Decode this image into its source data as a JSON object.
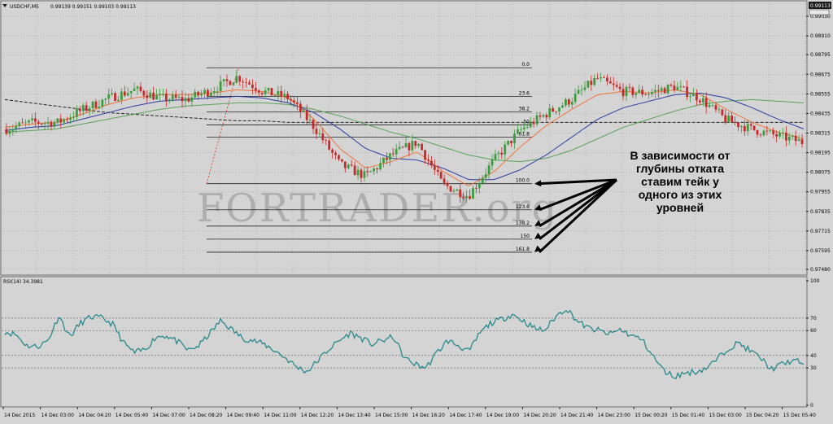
{
  "window": {
    "symbol_label": "USDCHF,M5",
    "ohlc_label": "0.99139 0.99151 0.99103 0.99113",
    "current_price_tag": "0.99113",
    "watermark": "FORTRADER.org"
  },
  "colors": {
    "background": "#d4d4d4",
    "grid": "#9a9a9a",
    "bull_candle": "#3c9b3c",
    "bear_candle": "#c82828",
    "ma_fast": "#f0743c",
    "ma_mid": "#2c3ca0",
    "ma_slow": "#5aa05a",
    "ma_long": "#222222",
    "rsi": "#2a8a8a",
    "fib": "#222222"
  },
  "annotation": {
    "lines": [
      "В зависимости от",
      "глубины отката",
      "ставим тейк у",
      "одного из этих",
      "уровней"
    ]
  },
  "chart_data": {
    "type": "candlestick",
    "symbol": "USDCHF",
    "timeframe": "M5",
    "price_axis": {
      "ticks": [
        "0.99030",
        "0.98910",
        "0.98795",
        "0.98675",
        "0.98555",
        "0.98435",
        "0.98315",
        "0.98195",
        "0.98075",
        "0.97955",
        "0.97835",
        "0.97715",
        "0.97595",
        "0.97480"
      ],
      "ylim": [
        0.9745,
        0.9912
      ]
    },
    "x_axis_ticks": [
      "14 Dec 2015",
      "14 Dec 03:00",
      "14 Dec 04:20",
      "14 Dec 05:40",
      "14 Dec 07:00",
      "14 Dec 08:20",
      "14 Dec 09:40",
      "14 Dec 11:00",
      "14 Dec 12:20",
      "14 Dec 13:40",
      "14 Dec 15:00",
      "14 Dec 16:20",
      "14 Dec 17:40",
      "14 Dec 19:00",
      "14 Dec 20:20",
      "14 Dec 21:40",
      "14 Dec 23:00",
      "15 Dec 00:20",
      "15 Dec 01:40",
      "15 Dec 03:00",
      "15 Dec 04:20",
      "15 Dec 05:40"
    ],
    "price_anchors": [
      0.9834,
      0.9838,
      0.9838,
      0.9846,
      0.9853,
      0.9858,
      0.9853,
      0.9852,
      0.9858,
      0.9866,
      0.9857,
      0.9853,
      0.9835,
      0.9812,
      0.9805,
      0.9818,
      0.9826,
      0.98,
      0.9793,
      0.9815,
      0.9833,
      0.9843,
      0.9852,
      0.9865,
      0.9857,
      0.9856,
      0.986,
      0.9853,
      0.984,
      0.9834,
      0.983,
      0.9826
    ],
    "ma_fast": [
      0.9835,
      0.9837,
      0.9838,
      0.9843,
      0.9849,
      0.9853,
      0.9855,
      0.9855,
      0.9856,
      0.9858,
      0.9857,
      0.9853,
      0.984,
      0.9822,
      0.981,
      0.9814,
      0.982,
      0.9808,
      0.9799,
      0.9808,
      0.9823,
      0.9836,
      0.9846,
      0.9855,
      0.9857,
      0.9856,
      0.9858,
      0.9855,
      0.9846,
      0.9838,
      0.9832,
      0.9828
    ],
    "ma_mid": [
      0.9833,
      0.9835,
      0.9836,
      0.984,
      0.9844,
      0.9848,
      0.9851,
      0.9852,
      0.9853,
      0.9854,
      0.9853,
      0.985,
      0.9844,
      0.9834,
      0.9822,
      0.9816,
      0.9815,
      0.981,
      0.9803,
      0.9803,
      0.9809,
      0.9818,
      0.9829,
      0.984,
      0.9847,
      0.9851,
      0.9855,
      0.9856,
      0.9853,
      0.9847,
      0.984,
      0.9834
    ],
    "ma_slow": [
      0.9832,
      0.9833,
      0.9834,
      0.9837,
      0.984,
      0.9843,
      0.9846,
      0.9848,
      0.9849,
      0.985,
      0.985,
      0.9849,
      0.9846,
      0.9842,
      0.9837,
      0.9832,
      0.9828,
      0.9823,
      0.9818,
      0.9815,
      0.9814,
      0.9816,
      0.9821,
      0.9828,
      0.9835,
      0.984,
      0.9845,
      0.9849,
      0.9851,
      0.9852,
      0.9851,
      0.985
    ],
    "ma_long": [
      0.9852,
      0.985,
      0.9848,
      0.9846,
      0.9844,
      0.9843,
      0.9842,
      0.9841,
      0.984,
      0.9839,
      0.9839,
      0.9838,
      0.9838,
      0.9838,
      0.9838,
      0.9838,
      0.9838,
      0.9838,
      0.9838,
      0.9838,
      0.9838,
      0.9838,
      0.9838,
      0.9838,
      0.9838,
      0.9838,
      0.9838,
      0.9838,
      0.9838,
      0.9838,
      0.9838,
      0.9838
    ],
    "fibonacci": {
      "swing_low": 0.98005,
      "swing_high": 0.98715,
      "levels": [
        {
          "label": "0.0",
          "price": 0.98715
        },
        {
          "label": "23.6",
          "price": 0.9854
        },
        {
          "label": "38.2",
          "price": 0.98445
        },
        {
          "label": "50",
          "price": 0.98365
        },
        {
          "label": "61.8",
          "price": 0.9829
        },
        {
          "label": "100.0",
          "price": 0.98005
        },
        {
          "label": "123.6",
          "price": 0.97845
        },
        {
          "label": "138.2",
          "price": 0.97745
        },
        {
          "label": "150",
          "price": 0.97665
        },
        {
          "label": "161.8",
          "price": 0.97585
        }
      ]
    },
    "rsi": {
      "label": "RSI(14) 34.3981",
      "ticks": [
        "100",
        "70",
        "60",
        "40",
        "30",
        "0"
      ],
      "levels": [
        70,
        60,
        40,
        30
      ],
      "ylim": [
        0,
        100
      ],
      "values": [
        59,
        57,
        48,
        47,
        52,
        72,
        55,
        66,
        71,
        70,
        65,
        50,
        42,
        45,
        55,
        56,
        51,
        44,
        48,
        58,
        68,
        61,
        54,
        52,
        49,
        44,
        38,
        31,
        27,
        36,
        45,
        52,
        58,
        54,
        49,
        52,
        55,
        38,
        33,
        30,
        42,
        52,
        48,
        43,
        58,
        66,
        69,
        73,
        68,
        62,
        60,
        71,
        78,
        68,
        62,
        60,
        57,
        61,
        56,
        53,
        40,
        28,
        23,
        26,
        27,
        30,
        37,
        46,
        50,
        44,
        38,
        29,
        33,
        36,
        34
      ]
    }
  }
}
